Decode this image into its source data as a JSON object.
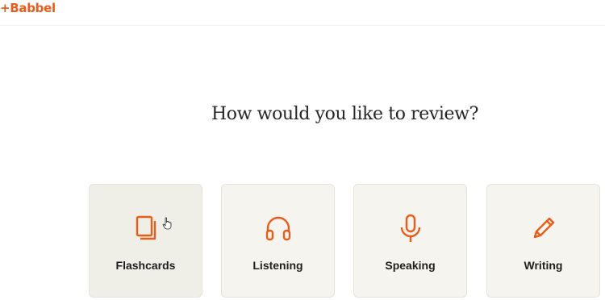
{
  "brand": {
    "logo_text": "+Babbel",
    "accent_color": "#e85d1c"
  },
  "main": {
    "title": "How would you like to review?"
  },
  "review_options": [
    {
      "label": "Flashcards",
      "icon": "flashcards-icon"
    },
    {
      "label": "Listening",
      "icon": "headphones-icon"
    },
    {
      "label": "Speaking",
      "icon": "microphone-icon"
    },
    {
      "label": "Writing",
      "icon": "pencil-icon"
    }
  ]
}
